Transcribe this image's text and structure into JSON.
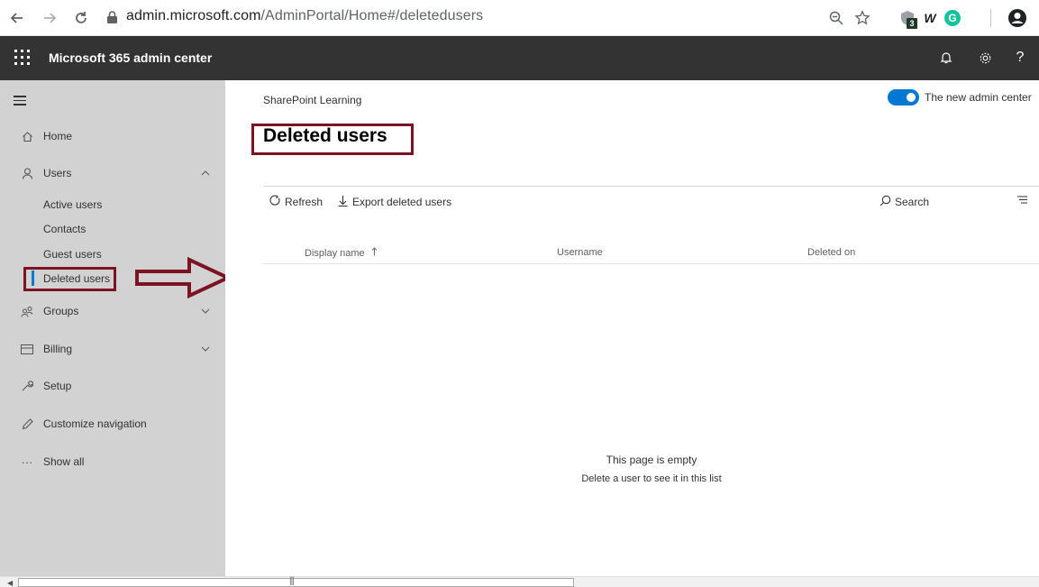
{
  "browser": {
    "url_host": "admin.microsoft.com",
    "url_path": "/AdminPortal/Home#/deletedusers",
    "extension_badge": "3",
    "ext_w_label": "W",
    "ext_g_label": "G"
  },
  "header": {
    "app_title": "Microsoft 365 admin center",
    "help_label": "?"
  },
  "sidebar": {
    "home": "Home",
    "users": "Users",
    "users_sub": [
      "Active users",
      "Contacts",
      "Guest users",
      "Deleted users"
    ],
    "groups": "Groups",
    "billing": "Billing",
    "setup": "Setup",
    "customize": "Customize navigation",
    "show_all": "Show all",
    "show_all_icon": "···"
  },
  "main": {
    "org_name": "SharePoint Learning",
    "toggle_label": "The new admin center",
    "page_title": "Deleted users",
    "commands": {
      "refresh": "Refresh",
      "export": "Export deleted users",
      "search": "Search"
    },
    "columns": {
      "display_name": "Display name",
      "username": "Username",
      "deleted_on": "Deleted on"
    },
    "empty_title": "This page is empty",
    "empty_subtitle": "Delete a user to see it in this list"
  },
  "colors": {
    "header_bg": "#333333",
    "sidebar_bg": "#d2d2d2",
    "accent": "#0078d4",
    "annotation": "#7b1322"
  },
  "icons": [
    "back-icon",
    "forward-icon",
    "reload-icon",
    "lock-icon",
    "zoom-icon",
    "star-icon",
    "profile-icon",
    "waffle-icon",
    "bell-icon",
    "gear-icon",
    "help-icon",
    "hamburger-icon",
    "home-icon",
    "user-icon",
    "group-icon",
    "billing-icon",
    "setup-icon",
    "pencil-icon",
    "refresh-icon",
    "download-icon",
    "search-icon",
    "filter-icon",
    "sort-up-icon"
  ]
}
